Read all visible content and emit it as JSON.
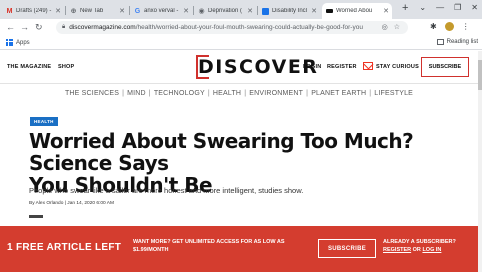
{
  "browser": {
    "tabs": [
      {
        "label": "Drafts (249) -",
        "favicon": "gmail-icon",
        "color": "#d93025",
        "glyph": "M"
      },
      {
        "label": "New Tab",
        "favicon": "newtab-icon",
        "color": "#5f6368",
        "glyph": "⊕"
      },
      {
        "label": "anxo verval -",
        "favicon": "google-icon",
        "color": "#4285f4",
        "glyph": "G"
      },
      {
        "label": "Deprivation (",
        "favicon": "page-icon",
        "color": "#5f6368",
        "glyph": "◉"
      },
      {
        "label": "Disability Incl",
        "favicon": "site-icon",
        "color": "#1a73e8",
        "glyph": "▭"
      },
      {
        "label": "Worried Abou",
        "favicon": "discover-favicon",
        "color": "#111111",
        "glyph": "▬"
      }
    ],
    "url_domain": "discovermagazine.com",
    "url_path": "/health/worried-about-your-foul-mouth-swearing-could-actually-be-good-for-you",
    "bookmarks": {
      "apps_label": "Apps",
      "reading_list": "Reading list"
    }
  },
  "header": {
    "magazine": "THE MAGAZINE",
    "shop": "SHOP",
    "logo": "DISCOVER",
    "login": "LOGIN",
    "register": "REGISTER",
    "stay_curious": "STAY CURIOUS",
    "subscribe": "SUBSCRIBE"
  },
  "categories": [
    "THE SCIENCES",
    "MIND",
    "TECHNOLOGY",
    "HEALTH",
    "ENVIRONMENT",
    "PLANET EARTH",
    "LIFESTYLE"
  ],
  "article": {
    "tag": "HEALTH",
    "headline_line1": "Worried About Swearing Too Much? Science Says",
    "headline_line2": "You Shouldn't Be",
    "dek": "People who swear like a sailor are more honest and more intelligent, studies show.",
    "byline": "By Alex Orlando  |  Jan 14, 2020 6:00 AM"
  },
  "paywall": {
    "title": "1 FREE ARTICLE LEFT",
    "offer_line1": "WANT MORE? GET UNLIMITED ACCESS FOR AS LOW AS",
    "offer_line2": "$1.99/MONTH",
    "subscribe": "SUBSCRIBE",
    "already": "ALREADY A SUBSCRIBER?",
    "register": "REGISTER",
    "or": " OR ",
    "login": "LOG IN"
  },
  "colors": {
    "brand_red": "#d43d2f",
    "tag_blue": "#1a6fc4"
  }
}
